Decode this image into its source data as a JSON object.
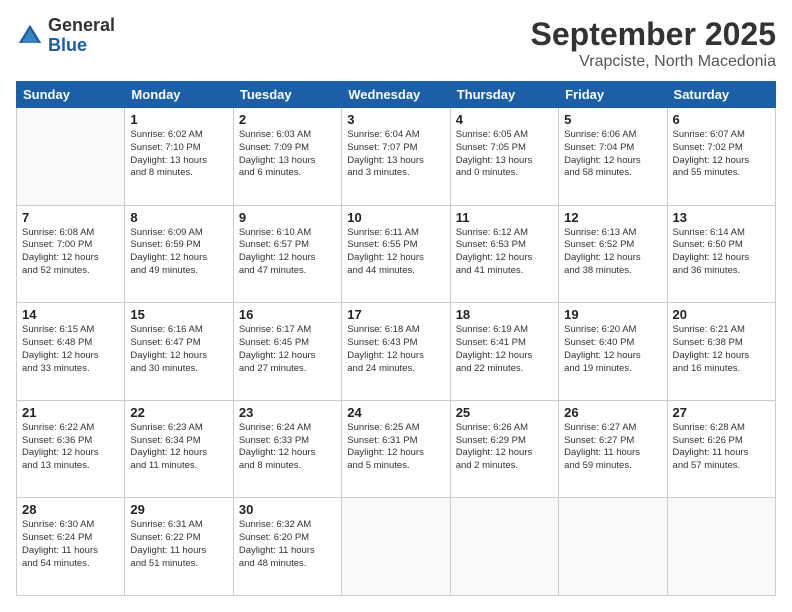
{
  "logo": {
    "general": "General",
    "blue": "Blue"
  },
  "header": {
    "month": "September 2025",
    "location": "Vrapciste, North Macedonia"
  },
  "weekdays": [
    "Sunday",
    "Monday",
    "Tuesday",
    "Wednesday",
    "Thursday",
    "Friday",
    "Saturday"
  ],
  "weeks": [
    [
      {
        "day": "",
        "info": ""
      },
      {
        "day": "1",
        "info": "Sunrise: 6:02 AM\nSunset: 7:10 PM\nDaylight: 13 hours\nand 8 minutes."
      },
      {
        "day": "2",
        "info": "Sunrise: 6:03 AM\nSunset: 7:09 PM\nDaylight: 13 hours\nand 6 minutes."
      },
      {
        "day": "3",
        "info": "Sunrise: 6:04 AM\nSunset: 7:07 PM\nDaylight: 13 hours\nand 3 minutes."
      },
      {
        "day": "4",
        "info": "Sunrise: 6:05 AM\nSunset: 7:05 PM\nDaylight: 13 hours\nand 0 minutes."
      },
      {
        "day": "5",
        "info": "Sunrise: 6:06 AM\nSunset: 7:04 PM\nDaylight: 12 hours\nand 58 minutes."
      },
      {
        "day": "6",
        "info": "Sunrise: 6:07 AM\nSunset: 7:02 PM\nDaylight: 12 hours\nand 55 minutes."
      }
    ],
    [
      {
        "day": "7",
        "info": "Sunrise: 6:08 AM\nSunset: 7:00 PM\nDaylight: 12 hours\nand 52 minutes."
      },
      {
        "day": "8",
        "info": "Sunrise: 6:09 AM\nSunset: 6:59 PM\nDaylight: 12 hours\nand 49 minutes."
      },
      {
        "day": "9",
        "info": "Sunrise: 6:10 AM\nSunset: 6:57 PM\nDaylight: 12 hours\nand 47 minutes."
      },
      {
        "day": "10",
        "info": "Sunrise: 6:11 AM\nSunset: 6:55 PM\nDaylight: 12 hours\nand 44 minutes."
      },
      {
        "day": "11",
        "info": "Sunrise: 6:12 AM\nSunset: 6:53 PM\nDaylight: 12 hours\nand 41 minutes."
      },
      {
        "day": "12",
        "info": "Sunrise: 6:13 AM\nSunset: 6:52 PM\nDaylight: 12 hours\nand 38 minutes."
      },
      {
        "day": "13",
        "info": "Sunrise: 6:14 AM\nSunset: 6:50 PM\nDaylight: 12 hours\nand 36 minutes."
      }
    ],
    [
      {
        "day": "14",
        "info": "Sunrise: 6:15 AM\nSunset: 6:48 PM\nDaylight: 12 hours\nand 33 minutes."
      },
      {
        "day": "15",
        "info": "Sunrise: 6:16 AM\nSunset: 6:47 PM\nDaylight: 12 hours\nand 30 minutes."
      },
      {
        "day": "16",
        "info": "Sunrise: 6:17 AM\nSunset: 6:45 PM\nDaylight: 12 hours\nand 27 minutes."
      },
      {
        "day": "17",
        "info": "Sunrise: 6:18 AM\nSunset: 6:43 PM\nDaylight: 12 hours\nand 24 minutes."
      },
      {
        "day": "18",
        "info": "Sunrise: 6:19 AM\nSunset: 6:41 PM\nDaylight: 12 hours\nand 22 minutes."
      },
      {
        "day": "19",
        "info": "Sunrise: 6:20 AM\nSunset: 6:40 PM\nDaylight: 12 hours\nand 19 minutes."
      },
      {
        "day": "20",
        "info": "Sunrise: 6:21 AM\nSunset: 6:38 PM\nDaylight: 12 hours\nand 16 minutes."
      }
    ],
    [
      {
        "day": "21",
        "info": "Sunrise: 6:22 AM\nSunset: 6:36 PM\nDaylight: 12 hours\nand 13 minutes."
      },
      {
        "day": "22",
        "info": "Sunrise: 6:23 AM\nSunset: 6:34 PM\nDaylight: 12 hours\nand 11 minutes."
      },
      {
        "day": "23",
        "info": "Sunrise: 6:24 AM\nSunset: 6:33 PM\nDaylight: 12 hours\nand 8 minutes."
      },
      {
        "day": "24",
        "info": "Sunrise: 6:25 AM\nSunset: 6:31 PM\nDaylight: 12 hours\nand 5 minutes."
      },
      {
        "day": "25",
        "info": "Sunrise: 6:26 AM\nSunset: 6:29 PM\nDaylight: 12 hours\nand 2 minutes."
      },
      {
        "day": "26",
        "info": "Sunrise: 6:27 AM\nSunset: 6:27 PM\nDaylight: 11 hours\nand 59 minutes."
      },
      {
        "day": "27",
        "info": "Sunrise: 6:28 AM\nSunset: 6:26 PM\nDaylight: 11 hours\nand 57 minutes."
      }
    ],
    [
      {
        "day": "28",
        "info": "Sunrise: 6:30 AM\nSunset: 6:24 PM\nDaylight: 11 hours\nand 54 minutes."
      },
      {
        "day": "29",
        "info": "Sunrise: 6:31 AM\nSunset: 6:22 PM\nDaylight: 11 hours\nand 51 minutes."
      },
      {
        "day": "30",
        "info": "Sunrise: 6:32 AM\nSunset: 6:20 PM\nDaylight: 11 hours\nand 48 minutes."
      },
      {
        "day": "",
        "info": ""
      },
      {
        "day": "",
        "info": ""
      },
      {
        "day": "",
        "info": ""
      },
      {
        "day": "",
        "info": ""
      }
    ]
  ]
}
